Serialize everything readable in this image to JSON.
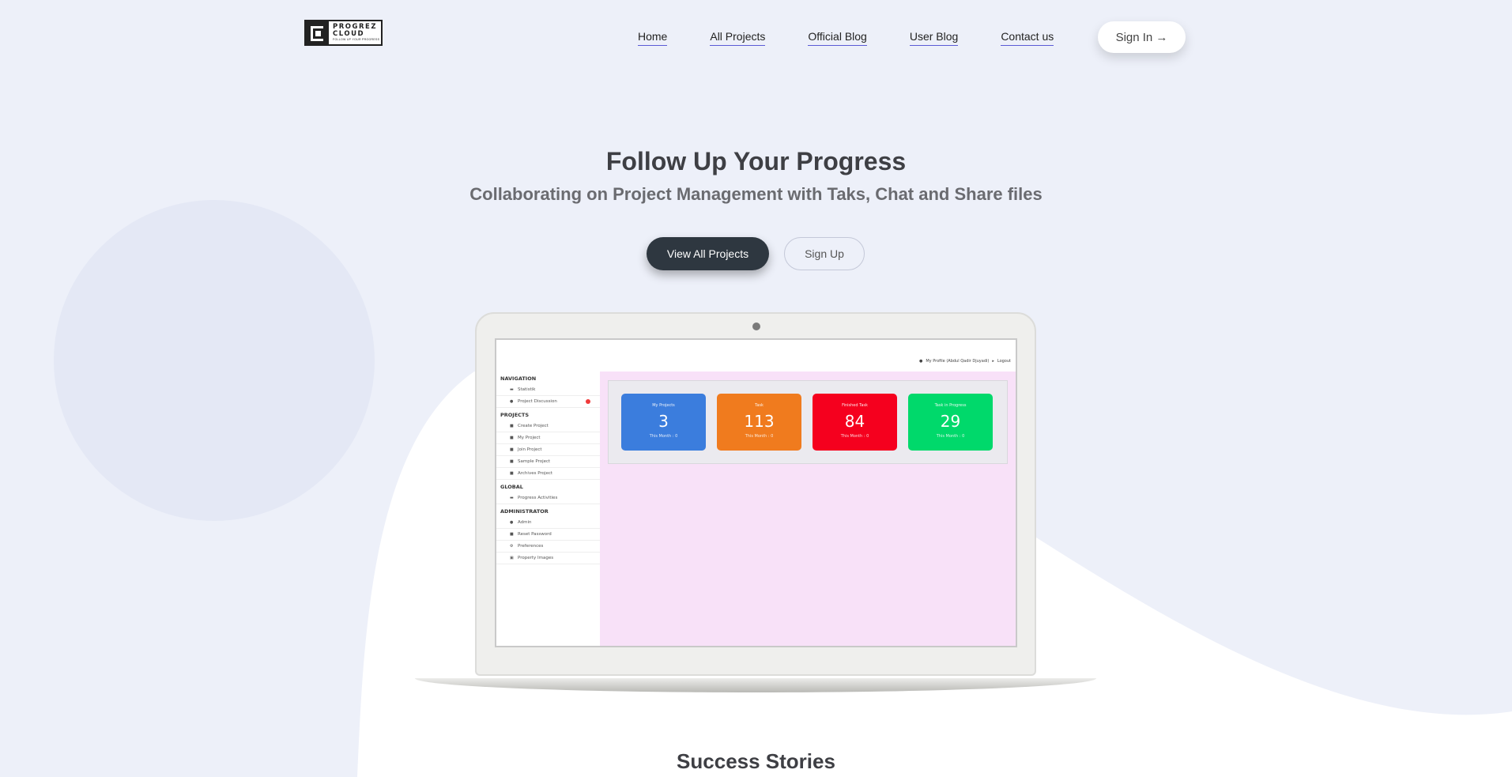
{
  "brand": {
    "title": "PROGREZ CLOUD",
    "tagline": "FOLLOW UP YOUR PROGRESS"
  },
  "nav": {
    "items": [
      {
        "label": "Home"
      },
      {
        "label": "All Projects"
      },
      {
        "label": "Official Blog"
      },
      {
        "label": "User Blog"
      },
      {
        "label": "Contact us"
      }
    ]
  },
  "signin": {
    "label": "Sign In →"
  },
  "hero": {
    "title": "Follow Up Your Progress",
    "subtitle": "Collaborating on Project Management with Taks, Chat and Share files",
    "primary_button": "View All Projects",
    "secondary_button": "Sign Up"
  },
  "app_preview": {
    "profile": "My Profile (Abdul Qadir Djuyadi)",
    "logout": "Logout",
    "sidebar": {
      "navigation_header": "NAVIGATION",
      "navigation": [
        "Statistik",
        "Project Discussion"
      ],
      "projects_header": "PROJECTS",
      "projects": [
        "Create Project",
        "My Project",
        "Join Project",
        "Sample Project",
        "Archives Project"
      ],
      "global_header": "GLOBAL",
      "global": [
        "Progress Activities"
      ],
      "admin_header": "ADMINISTRATOR",
      "admin": [
        "Admin",
        "Reset Password",
        "Preferences",
        "Property Images"
      ]
    },
    "cards": [
      {
        "label": "My Projects",
        "value": "3",
        "foot": "This Month : 0",
        "color": "#3b7ddd"
      },
      {
        "label": "Task",
        "value": "113",
        "foot": "This Month : 0",
        "color": "#f07b1e"
      },
      {
        "label": "Finished Task",
        "value": "84",
        "foot": "This Month : 0",
        "color": "#f5001e"
      },
      {
        "label": "Task in Progress",
        "value": "29",
        "foot": "This Month : 0",
        "color": "#00d96b"
      }
    ]
  },
  "stories": {
    "title": "Success Stories"
  }
}
